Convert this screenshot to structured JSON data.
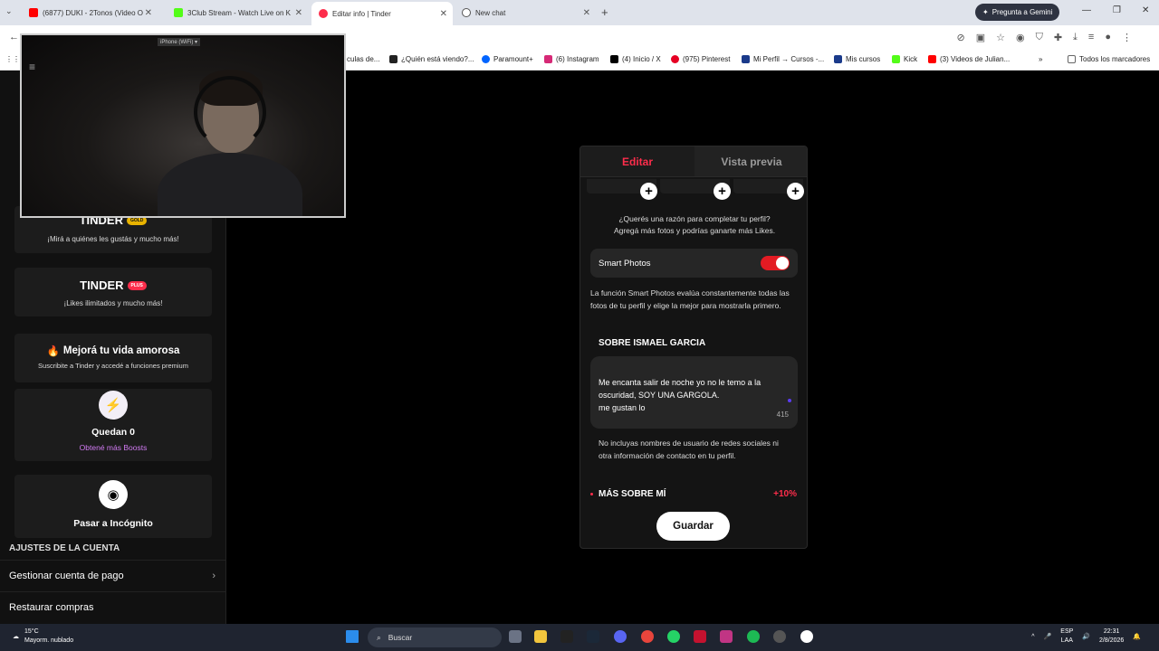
{
  "browser": {
    "tabs": [
      {
        "title": "(6877) DUKI - 2Tonos (Video O",
        "color": "#ff0000"
      },
      {
        "title": "3Club Stream - Watch Live on K",
        "color": "#53fc18"
      },
      {
        "title": "Editar info | Tinder",
        "color": "#fd2d4b"
      },
      {
        "title": "New chat",
        "color": "#555555"
      }
    ],
    "gemini_label": "Pregunta a Gemini",
    "bookmarks": [
      {
        "label": "culas de...",
        "color": "#888888"
      },
      {
        "label": "¿Quién está viendo?...",
        "color": "#222222"
      },
      {
        "label": "Paramount+",
        "color": "#0064ff"
      },
      {
        "label": "(6) Instagram",
        "color": "#d62976"
      },
      {
        "label": "(4) Inicio / X",
        "color": "#000000"
      },
      {
        "label": "(975) Pinterest",
        "color": "#e60023"
      },
      {
        "label": "Mi Perfil → Cursos -...",
        "color": "#1a3a8a"
      },
      {
        "label": "Mis cursos",
        "color": "#1a3a8a"
      },
      {
        "label": "Kick",
        "color": "#53fc18"
      },
      {
        "label": "(3) Videos de Julian...",
        "color": "#ff0000"
      },
      {
        "label": "Todos los marcadores",
        "color": "#666666"
      }
    ]
  },
  "webcam": {
    "device_label": "iPhone (WiFi)"
  },
  "left": {
    "gold": {
      "logo": "TINDER",
      "badge": "GOLD",
      "sub": "¡Mirá a quiénes les gustás y mucho más!"
    },
    "plus": {
      "logo": "TINDER",
      "badge": "PLUS",
      "sub": "¡Likes ilimitados y mucho más!"
    },
    "premium": {
      "title": "Mejorá tu vida amorosa",
      "sub": "Suscribite a Tinder y accedé a funciones premium"
    },
    "boosts": {
      "title": "Quedan 0",
      "link": "Obtené más Boosts"
    },
    "incognito": {
      "title": "Pasar a Incógnito"
    },
    "account_header": "AJUSTES DE LA CUENTA",
    "rows": [
      "Gestionar cuenta de pago",
      "Restaurar compras"
    ]
  },
  "editor": {
    "tab_edit": "Editar",
    "tab_preview": "Vista previa",
    "why_line1": "¿Querés una razón para completar tu perfil?",
    "why_line2": "Agregá más fotos y podrías ganarte más Likes.",
    "smart_photos_label": "Smart Photos",
    "smart_photos_on": true,
    "smart_photos_desc": "La función Smart Photos evalúa constantemente todas las fotos de tu perfil y elige la mejor para mostrarla primero.",
    "about_title": "SOBRE ISMAEL GARCIA",
    "bio_text": "Me encanta salir de noche yo no le temo a la oscuridad, SOY UNA GARGOLA.\nme gustan lo",
    "bio_remaining": "415",
    "warning": "No incluyas nombres de usuario de redes sociales ni otra información de contacto en tu perfil.",
    "more_title": "MÁS SOBRE MÍ",
    "more_pct": "+10%",
    "save_label": "Guardar"
  },
  "taskbar": {
    "temp": "15°C",
    "weather": "Mayorm. nublado",
    "search_placeholder": "Buscar",
    "lang_line1": "ESP",
    "lang_line2": "LAA",
    "time": "22:31",
    "date": "2/8/2026"
  }
}
